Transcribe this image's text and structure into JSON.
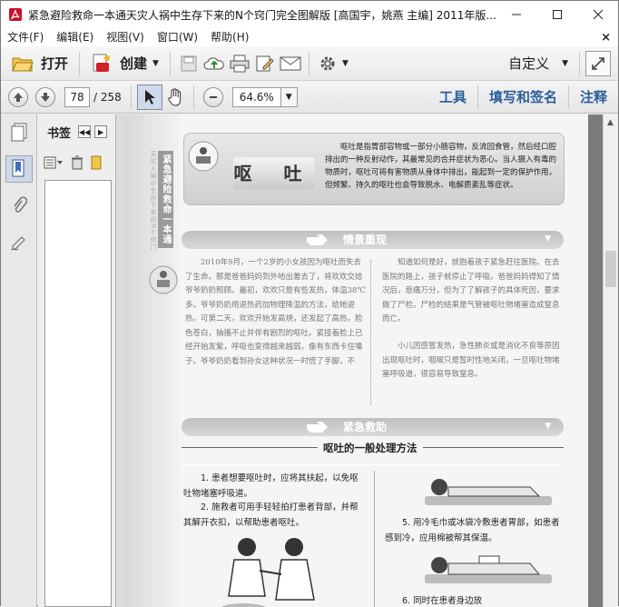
{
  "window": {
    "title": "紧急避险救命一本通天灾人祸中生存下来的N个窍门完全图解版 [高国宇，姚燕 主编] 2011年版...",
    "controls": [
      "minimize",
      "maximize",
      "close"
    ]
  },
  "menu": {
    "items": [
      "文件(F)",
      "编辑(E)",
      "视图(V)",
      "窗口(W)",
      "帮助(H)"
    ],
    "close": "×"
  },
  "toolbar": {
    "open_label": "打开",
    "create_label": "创建",
    "customize_label": "自定义"
  },
  "nav": {
    "current_page": "78",
    "total_pages": "/ 258",
    "zoom": "64.6%",
    "tools_label": "工具",
    "fill_sign_label": "填写和签名",
    "comment_label": "注释"
  },
  "bookmarks": {
    "title": "书签"
  },
  "page": {
    "side_title": "紧急避险救命一本通",
    "side_subtitle": "天灾人祸中生存下来的N个窍门",
    "heading": "呕 吐",
    "intro": "呕吐是指胃部容物或一部分小肠容物，反流回食管，然后经口腔排出的一种反射动作，其最常见的合并症状为恶心。当人摄入有毒的物质时，呕吐可将有害物质从身体中排出，能起到一定的保护作用，但频繁、持久的呕吐也会导致脱水、电解质紊乱等症状。",
    "section1": "情景重现",
    "story_left": "2010年9月，一个2岁的小女孩因为呕吐而失去了生命。那是爸爸妈妈到外地出差去了，将欢欢交给爷爷奶奶照顾。最初，欢欢只是有些发热，体温38℃多。爷爷奶奶用退热药加物理降温的方法，给她退热。可第二天，欢欢开始发高烧，还发起了高热，脸色苍白，抽搐不止并伴有剧烈的呕吐。紧接着脸上已经开始发紫，呼吸也变得越来越弱，像有东西卡住嗓子。爷爷奶奶看到孙女这种状况一时慌了手脚，不",
    "story_right": "知道如何是好，就抱着孩子紧急赶往医院。在去医院的路上，孩子就停止了呼吸。爸爸妈妈得知了情况后，悲痛万分，但为了了解孩子的具体死因，要求做了尸检。尸检的结果是气管被呕吐物堵塞造成窒息而亡。",
    "story_right2": "小儿因感冒发热，急性肺炎或是消化不良等原因出现呕吐时，咽喉只是暂时性地关闭，一旦呕吐物堵塞呼吸道，很容易导致窒息。",
    "section2": "紧急救助",
    "subheading": "呕吐的一般处理方法",
    "step1": "1. 患者想要呕吐时，应将其扶起，以免呕吐物堵塞呼吸道。",
    "step2": "2. 施救者可用手轻轻拍打患者背部，并帮其解开衣扣，以帮助患者呕吐。",
    "step5": "5. 用冷毛巾或冰袋冷敷患者胃部，如患者感到冷，应用棉被帮其保温。",
    "step6": "6. 同时在患者身边放"
  },
  "colors": {
    "link_blue": "#2b5d9c",
    "toolbar_bg": "#ececec",
    "doc_bg": "#7b7b7b"
  }
}
